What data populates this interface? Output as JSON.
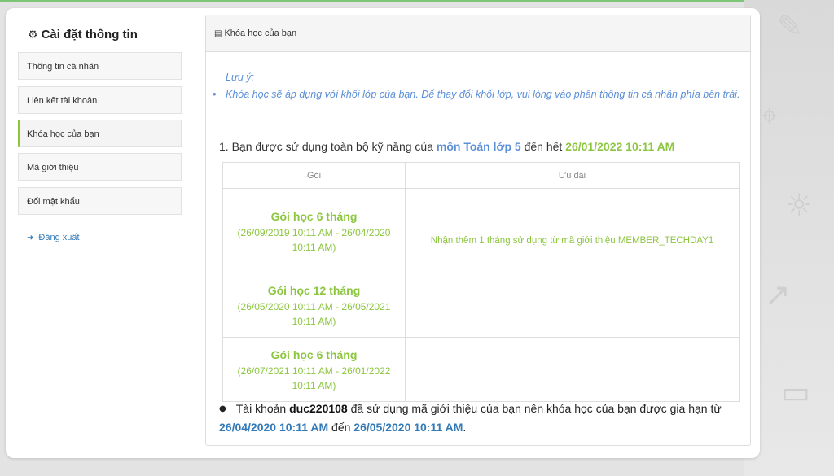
{
  "sidebar": {
    "title": "Cài đặt thông tin",
    "items": [
      {
        "label": "Thông tin cá nhân"
      },
      {
        "label": "Liên kết tài khoản"
      },
      {
        "label": "Khóa học của bạn"
      },
      {
        "label": "Mã giới thiệu"
      },
      {
        "label": "Đổi mật khẩu"
      }
    ],
    "active_index": 2,
    "logout_label": "Đăng xuất"
  },
  "panel": {
    "title": "Khóa học của bạn",
    "note_heading": "Lưu ý:",
    "note_text": "Khóa học sẽ áp dụng với khối lớp của bạn. Để thay đổi khối lớp, vui lòng vào phần thông tin cá nhân phía bên trái.",
    "usage": {
      "prefix": "1. Bạn được sử dụng toàn bộ kỹ năng của",
      "subject": "môn Toán lớp 5",
      "middle": "đến hết",
      "expiry": "26/01/2022 10:11 AM"
    },
    "table": {
      "headers": [
        "Gói",
        "Ưu đãi"
      ],
      "rows": [
        {
          "name": "Gói học 6 tháng",
          "period": "(26/09/2019 10:11 AM - 26/04/2020 10:11 AM)",
          "offer": "Nhận thêm 1 tháng sử dụng từ mã giới thiệu MEMBER_TECHDAY1"
        },
        {
          "name": "Gói học 12 tháng",
          "period": "(26/05/2020 10:11 AM - 26/05/2021 10:11 AM)",
          "offer": ""
        },
        {
          "name": "Gói học 6 tháng",
          "period": "(26/07/2021 10:11 AM - 26/01/2022 10:11 AM)",
          "offer": ""
        }
      ]
    },
    "extension": {
      "prefix": "Tài khoản",
      "account": "duc220108",
      "middle": "đã sử dụng mã giới thiệu của bạn nên khóa học của bạn được gia hạn từ",
      "from": "26/04/2020 10:11 AM",
      "to_word": "đến",
      "to": "26/05/2020 10:11 AM",
      "suffix": "."
    }
  },
  "colors": {
    "accent_green": "#8cc63f",
    "link_blue": "#337ab7",
    "note_blue": "#5b8fd8"
  }
}
